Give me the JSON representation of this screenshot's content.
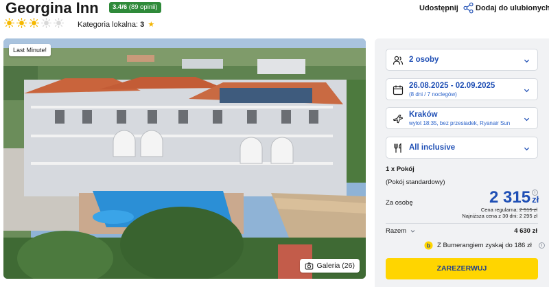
{
  "hotel": {
    "name": "Georgina Inn",
    "rating_score": "3.4/6",
    "rating_count": "(89 opinii)",
    "sun_rating": 3,
    "sun_max": 5,
    "local_category_label": "Kategoria lokalna:",
    "local_category_value": "3"
  },
  "actions": {
    "share_label": "Udostępnij",
    "favorite_label": "Dodaj do ulubionych"
  },
  "photo": {
    "badge": "Last Minute!",
    "gallery_label": "Galeria (26)"
  },
  "booking": {
    "persons": "2 osoby",
    "dates": "26.08.2025 - 02.09.2025",
    "dates_sub": "(8 dni / 7 noclegów)",
    "departure": "Kraków",
    "departure_sub": "wylot 18:35, bez przesiadek, Ryanair Sun",
    "board": "All inclusive",
    "room_count": "1 x Pokój",
    "room_type": "(Pokój standardowy)",
    "per_person_label": "Za osobę",
    "price": "2 315",
    "currency": "zł",
    "regular_price_label": "Cena regularna:",
    "regular_price_value": "2 515 zł",
    "lowest_price_text": "Najniższa cena z 30 dni: 2 295 zł",
    "total_label": "Razem",
    "total_value": "4 630 zł",
    "bonus_text": "Z Bumerangiem zyskaj do 186 zł",
    "book_label": "ZAREZERWUJ"
  },
  "colors": {
    "accent_blue": "#1f4fb5",
    "rating_green": "#2f8a3a",
    "book_yellow": "#ffd500",
    "sun_active": "#f5b800",
    "sun_inactive": "#d9d9d9"
  }
}
